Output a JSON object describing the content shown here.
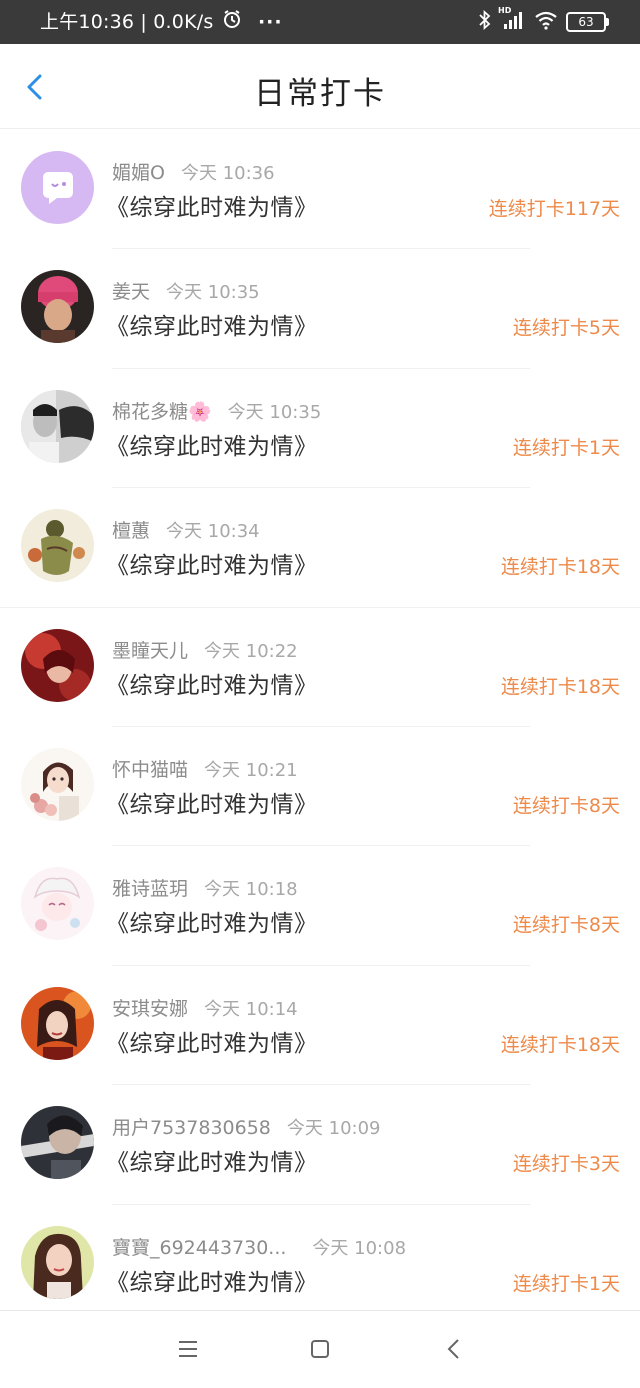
{
  "status_bar": {
    "time": "上午10:36",
    "speed": "0.0K/s",
    "more": "···",
    "battery": "63",
    "signal_label": "HD"
  },
  "header": {
    "title": "日常打卡"
  },
  "colors": {
    "accent_back": "#2b8fe6",
    "streak": "#ee8a4a"
  },
  "list": {
    "items": [
      {
        "name": "媚媚O",
        "time": "今天 10:36",
        "book": "《综穿此时难为情》",
        "streak": "连续打卡117天",
        "avatar": "purple-chat-icon"
      },
      {
        "name": "姜天",
        "time": "今天 10:35",
        "book": "《综穿此时难为情》",
        "streak": "连续打卡5天",
        "avatar": "pink-beanie-photo"
      },
      {
        "name": "棉花多糖🌸",
        "time": "今天 10:35",
        "book": "《综穿此时难为情》",
        "streak": "连续打卡1天",
        "avatar": "bw-portrait"
      },
      {
        "name": "檀蕙",
        "time": "今天 10:34",
        "book": "《综穿此时难为情》",
        "streak": "连续打卡18天",
        "avatar": "illustration"
      },
      {
        "name": "墨瞳天儿",
        "time": "今天 10:22",
        "book": "《综穿此时难为情》",
        "streak": "连续打卡18天",
        "avatar": "red-illustration"
      },
      {
        "name": "怀中猫喵",
        "time": "今天 10:21",
        "book": "《综穿此时难为情》",
        "streak": "连续打卡8天",
        "avatar": "girl-illustration"
      },
      {
        "name": "雅诗蓝玥",
        "time": "今天 10:18",
        "book": "《综穿此时难为情》",
        "streak": "连续打卡8天",
        "avatar": "pastel-illustration"
      },
      {
        "name": "安琪安娜",
        "time": "今天 10:14",
        "book": "《综穿此时难为情》",
        "streak": "连续打卡18天",
        "avatar": "orange-illustration"
      },
      {
        "name": "用户7537830658",
        "time": "今天 10:09",
        "book": "《综穿此时难为情》",
        "streak": "连续打卡3天",
        "avatar": "dark-photo"
      },
      {
        "name": "寶寶_692443730...",
        "time": "今天 10:08",
        "book": "《综穿此时难为情》",
        "streak": "连续打卡1天",
        "avatar": "girl-photo"
      }
    ]
  }
}
